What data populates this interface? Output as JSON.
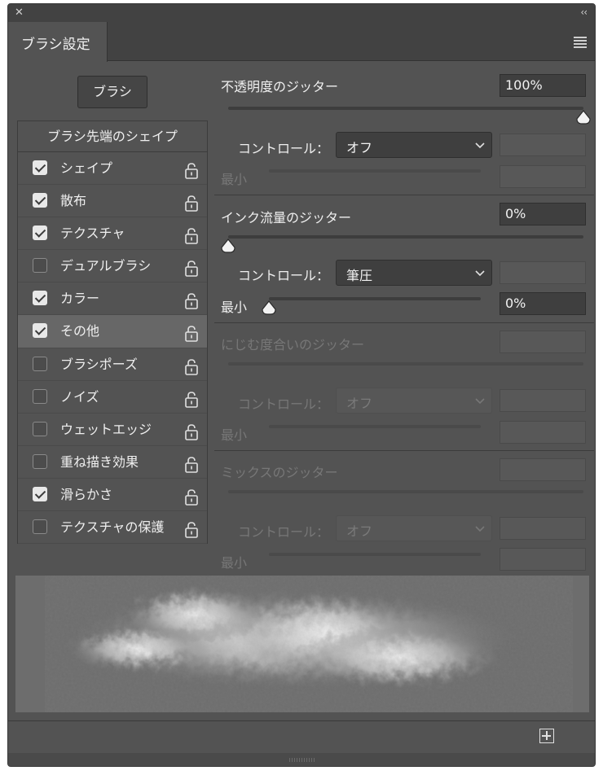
{
  "window": {
    "close_icon": "close-x-icon",
    "collapse_icon": "double-chevron-left-icon"
  },
  "tab": {
    "label": "ブラシ設定"
  },
  "brush_button": {
    "label": "ブラシ"
  },
  "list": {
    "header": "ブラシ先端のシェイプ",
    "items": [
      {
        "label": "シェイプ",
        "checked": true
      },
      {
        "label": "散布",
        "checked": true
      },
      {
        "label": "テクスチャ",
        "checked": true
      },
      {
        "label": "デュアルブラシ",
        "checked": false
      },
      {
        "label": "カラー",
        "checked": true
      },
      {
        "label": "その他",
        "checked": true,
        "selected": true
      },
      {
        "label": "ブラシポーズ",
        "checked": false
      },
      {
        "label": "ノイズ",
        "checked": false
      },
      {
        "label": "ウェットエッジ",
        "checked": false
      },
      {
        "label": "重ね描き効果",
        "checked": false
      },
      {
        "label": "滑らかさ",
        "checked": true
      },
      {
        "label": "テクスチャの保護",
        "checked": false
      }
    ]
  },
  "opacity_jitter": {
    "label": "不透明度のジッター",
    "value": "100%",
    "slider_fraction": 1.0,
    "control_label": "コントロール：",
    "control_value": "オフ",
    "min_label": "最小"
  },
  "flow_jitter": {
    "label": "インク流量のジッター",
    "value": "0%",
    "slider_fraction": 0.0,
    "control_label": "コントロール：",
    "control_value": "筆圧",
    "min_label": "最小",
    "min_value": "0%",
    "min_fraction": 0.0
  },
  "wetness_jitter": {
    "label": "にじむ度合いのジッター",
    "control_label": "コントロール：",
    "control_value": "オフ",
    "min_label": "最小"
  },
  "mix_jitter": {
    "label": "ミックスのジッター",
    "control_label": "コントロール：",
    "control_value": "オフ",
    "min_label": "最小"
  },
  "footer": {
    "new_preset_icon": "plus-square-icon"
  },
  "colors": {
    "panel_bg": "#535353",
    "dark_field": "#3f3f3f",
    "text": "#efefef",
    "dim_text": "#777777"
  }
}
